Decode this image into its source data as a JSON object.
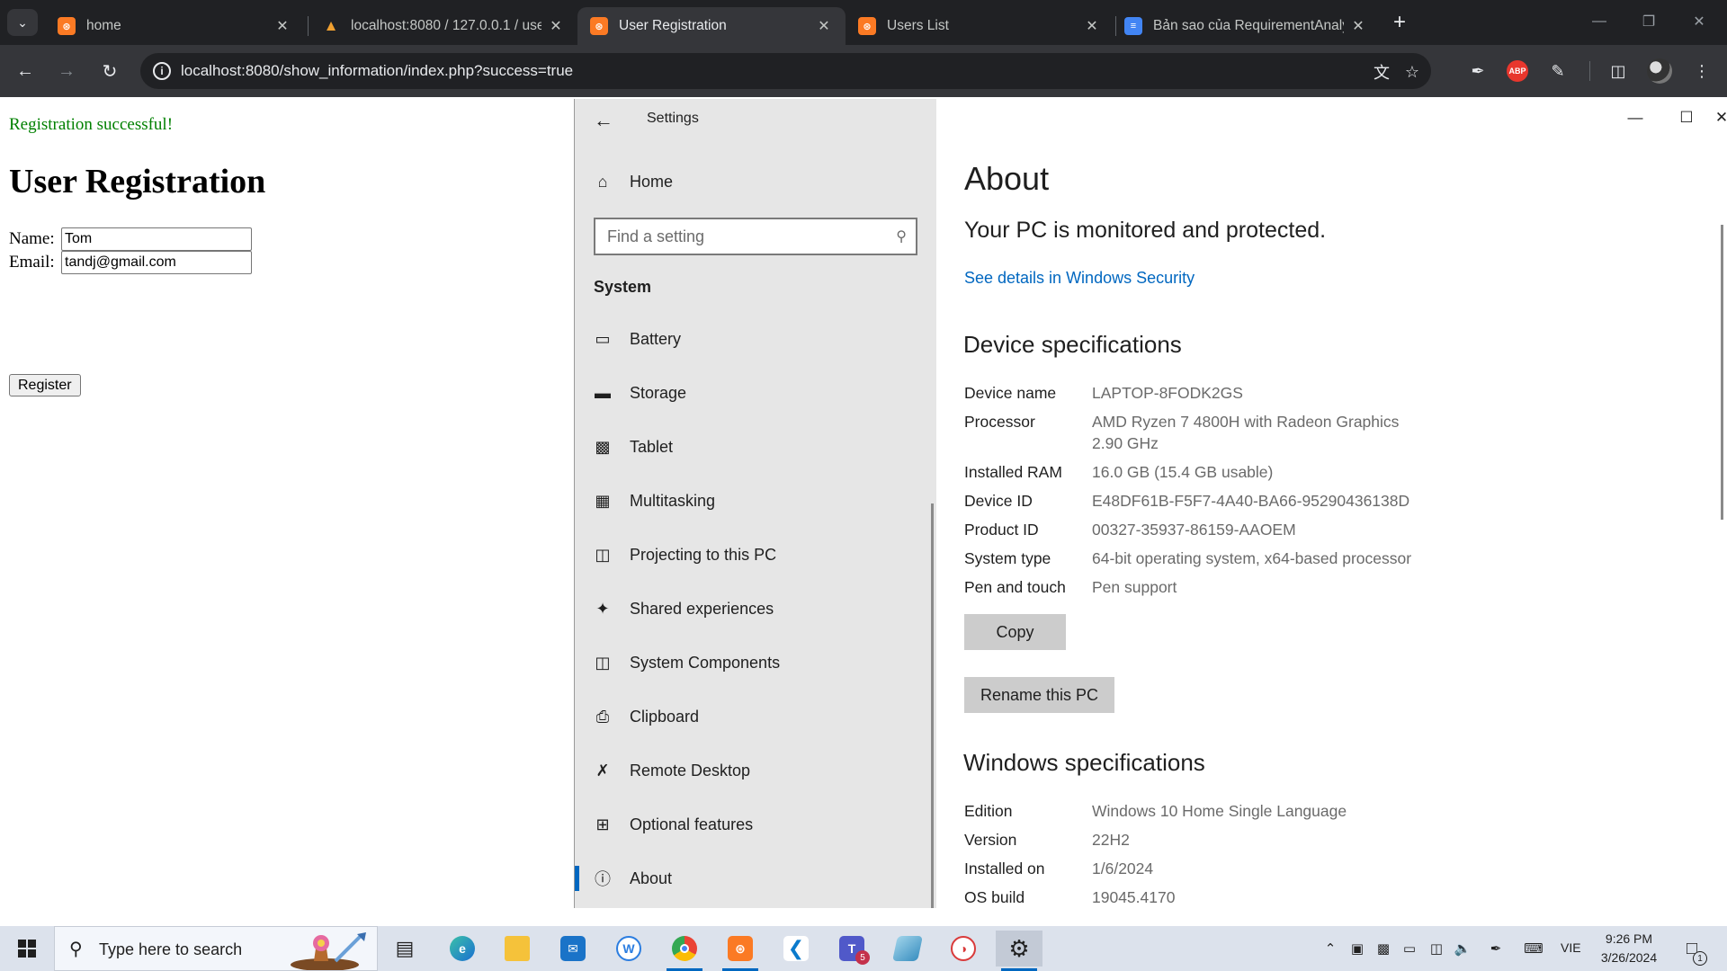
{
  "browser": {
    "tabs": [
      {
        "title": "home",
        "favicon": "xampp-icon"
      },
      {
        "title": "localhost:8080 / 127.0.0.1 / use",
        "favicon": "phpmyadmin-icon"
      },
      {
        "title": "User Registration",
        "favicon": "xampp-icon",
        "active": true
      },
      {
        "title": "Users List",
        "favicon": "xampp-icon"
      },
      {
        "title": "Bản sao của RequirementAnaly",
        "favicon": "docs-icon"
      }
    ],
    "url": "localhost:8080/show_information/index.php?success=true",
    "extensions": {
      "abp_label": "ABP"
    }
  },
  "webpage": {
    "success_message": "Registration successful!",
    "heading": "User Registration",
    "name_label": "Name:",
    "name_value": "Tom",
    "email_label": "Email:",
    "email_value": "tandj@gmail.com",
    "register_button": "Register"
  },
  "settings": {
    "window_title": "Settings",
    "nav": {
      "home": "Home",
      "search_placeholder": "Find a setting",
      "section": "System",
      "items": [
        {
          "label": "Battery",
          "icon": "battery-icon"
        },
        {
          "label": "Storage",
          "icon": "storage-icon"
        },
        {
          "label": "Tablet",
          "icon": "tablet-icon"
        },
        {
          "label": "Multitasking",
          "icon": "multitasking-icon"
        },
        {
          "label": "Projecting to this PC",
          "icon": "projecting-icon"
        },
        {
          "label": "Shared experiences",
          "icon": "shared-experiences-icon"
        },
        {
          "label": "System Components",
          "icon": "system-components-icon"
        },
        {
          "label": "Clipboard",
          "icon": "clipboard-icon"
        },
        {
          "label": "Remote Desktop",
          "icon": "remote-desktop-icon"
        },
        {
          "label": "Optional features",
          "icon": "optional-features-icon"
        },
        {
          "label": "About",
          "icon": "info-icon",
          "selected": true
        }
      ]
    },
    "about": {
      "title": "About",
      "protection": "Your PC is monitored and protected.",
      "security_link": "See details in Windows Security",
      "device_heading": "Device specifications",
      "device_specs": [
        {
          "key": "Device name",
          "value": "LAPTOP-8FODK2GS"
        },
        {
          "key": "Processor",
          "value": "AMD Ryzen 7 4800H with Radeon Graphics",
          "value2": "2.90 GHz"
        },
        {
          "key": "Installed RAM",
          "value": "16.0 GB (15.4 GB usable)"
        },
        {
          "key": "Device ID",
          "value": "E48DF61B-F5F7-4A40-BA66-95290436138D"
        },
        {
          "key": "Product ID",
          "value": "00327-35937-86159-AAOEM"
        },
        {
          "key": "System type",
          "value": "64-bit operating system, x64-based processor"
        },
        {
          "key": "Pen and touch",
          "value": "Pen support"
        }
      ],
      "copy_button": "Copy",
      "rename_button": "Rename this PC",
      "windows_heading": "Windows specifications",
      "windows_specs": [
        {
          "key": "Edition",
          "value": "Windows 10 Home Single Language"
        },
        {
          "key": "Version",
          "value": "22H2"
        },
        {
          "key": "Installed on",
          "value": "1/6/2024"
        },
        {
          "key": "OS build",
          "value": "19045.4170"
        }
      ]
    }
  },
  "taskbar": {
    "search_placeholder": "Type here to search",
    "teams_badge": "5",
    "language": "VIE",
    "time": "9:26 PM",
    "date": "3/26/2024",
    "notification_count": "1"
  },
  "colors": {
    "accent": "#0067c0",
    "success": "#008000",
    "chrome_dark": "#202124",
    "chrome_toolbar": "#35363a"
  }
}
